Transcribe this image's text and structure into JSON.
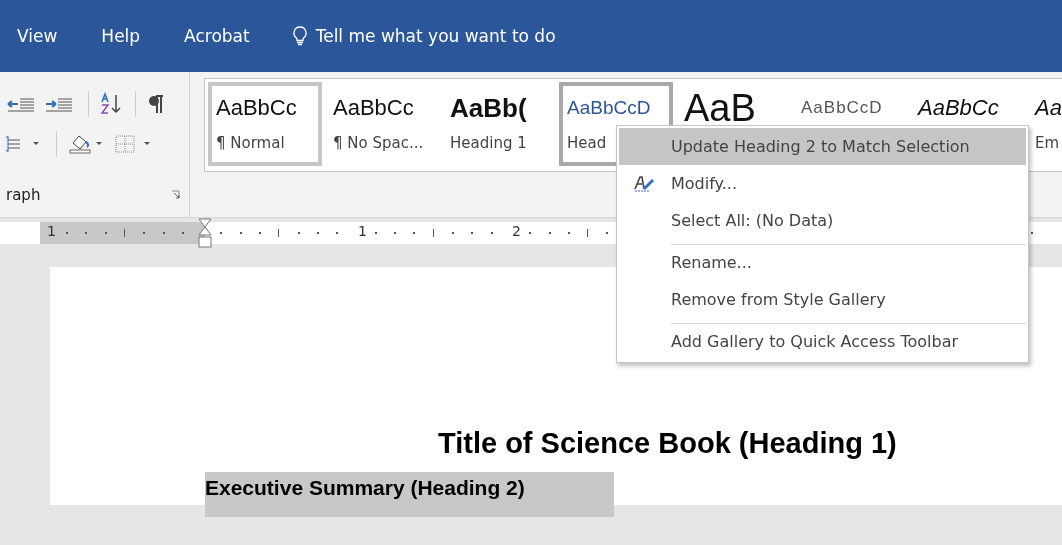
{
  "menu_bar": {
    "items": [
      {
        "label": "View"
      },
      {
        "label": "Help"
      },
      {
        "label": "Acrobat"
      }
    ],
    "tell_me": {
      "placeholder": "Tell me what you want to do"
    }
  },
  "paragraph_group": {
    "label": "raph"
  },
  "style_gallery": [
    {
      "preview": "AaBbCc",
      "label": "¶ Normal",
      "kind": "normal",
      "selected": true,
      "highlighted": false
    },
    {
      "preview": "AaBbCc",
      "label": "¶ No Spac...",
      "kind": "normal",
      "selected": false,
      "highlighted": false
    },
    {
      "preview": "AaBb(",
      "label": "Heading 1",
      "kind": "heading1",
      "selected": false,
      "highlighted": false
    },
    {
      "preview": "AaBbCcD",
      "label": "Head",
      "kind": "heading2",
      "selected": false,
      "highlighted": true
    },
    {
      "preview": "AaB",
      "kind": "title",
      "selected": false,
      "highlighted": false
    },
    {
      "preview": "AaBbCcD",
      "kind": "subtitle",
      "selected": false,
      "highlighted": false
    },
    {
      "preview": "AaBbCc",
      "kind": "emphasis",
      "selected": false,
      "highlighted": false
    },
    {
      "preview": "Aa",
      "label": "Em",
      "kind": "emphasis",
      "selected": false,
      "highlighted": false
    }
  ],
  "ruler": {
    "numbers": [
      "1",
      "1",
      "2"
    ]
  },
  "context_menu": [
    {
      "label": "Update Heading 2 to Match Selection",
      "highlighted": true,
      "separator_before": false,
      "has_icon": false
    },
    {
      "label": "Modify...",
      "highlighted": false,
      "separator_before": false,
      "has_icon": true
    },
    {
      "label": "Select All: (No Data)",
      "highlighted": false,
      "separator_before": false,
      "has_icon": false
    },
    {
      "label": "Rename...",
      "highlighted": false,
      "separator_before": true,
      "has_icon": false
    },
    {
      "label": "Remove from Style Gallery",
      "highlighted": false,
      "separator_before": false,
      "has_icon": false
    },
    {
      "label": "Add Gallery to Quick Access Toolbar",
      "highlighted": false,
      "separator_before": true,
      "has_icon": false
    }
  ],
  "document": {
    "title": "Title of Science Book (Heading 1)",
    "heading2": {
      "text": "Executive Summary (Heading 2)",
      "selected": true
    }
  }
}
